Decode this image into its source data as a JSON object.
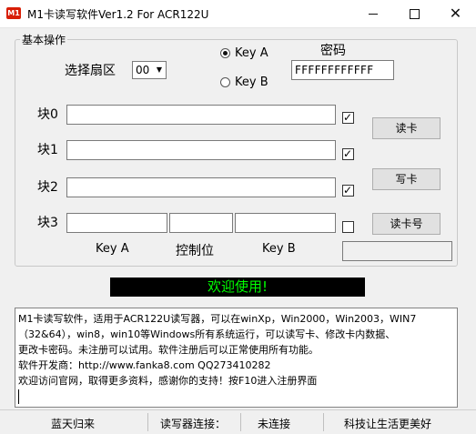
{
  "window": {
    "icon_text": "M1",
    "title": "M1卡读写软件Ver1.2 For ACR122U",
    "minimize": "",
    "maximize": "",
    "close": "✕"
  },
  "group": {
    "legend": "基本操作",
    "sector_label": "选择扇区",
    "sector_value": "00",
    "key_a_label": "Key A",
    "key_a_selected": true,
    "key_b_label": "Key B",
    "password_label": "密码",
    "password_value": "FFFFFFFFFFFF",
    "blocks": [
      {
        "label": "块0",
        "checked": true
      },
      {
        "label": "块1",
        "checked": true
      },
      {
        "label": "块2",
        "checked": true
      },
      {
        "label": "块3",
        "checked": false
      }
    ],
    "block3_sub_labels": {
      "key_a": "Key A",
      "control": "控制位",
      "key_b": "Key B"
    },
    "buttons": {
      "read": "读卡",
      "write": "写卡",
      "read_card_no": "读卡号"
    },
    "card_no_value": ""
  },
  "welcome_text": "欢迎使用!",
  "info_lines": [
    "M1卡读写软件，适用于ACR122U读写器，可以在winXp，Win2000，Win2003，WIN7",
    "（32&64），win8，win10等Windows所有系统运行，可以读写卡、修改卡内数据、",
    "更改卡密码。未注册可以试用。软件注册后可以正常使用所有功能。",
    "软件开发商：http://www.fanka8.com QQ273410282",
    "欢迎访问官网，取得更多资料，感谢你的支持！按F10进入注册界面"
  ],
  "status_bar": {
    "company": "蓝天归来",
    "reader_label": "读写器连接：",
    "reader_status": "未连接",
    "tech": "科技让生活更美好"
  },
  "colors": {
    "welcome_bg": "#000000",
    "welcome_fg": "#00ff00",
    "app_icon": "#d81e06"
  }
}
